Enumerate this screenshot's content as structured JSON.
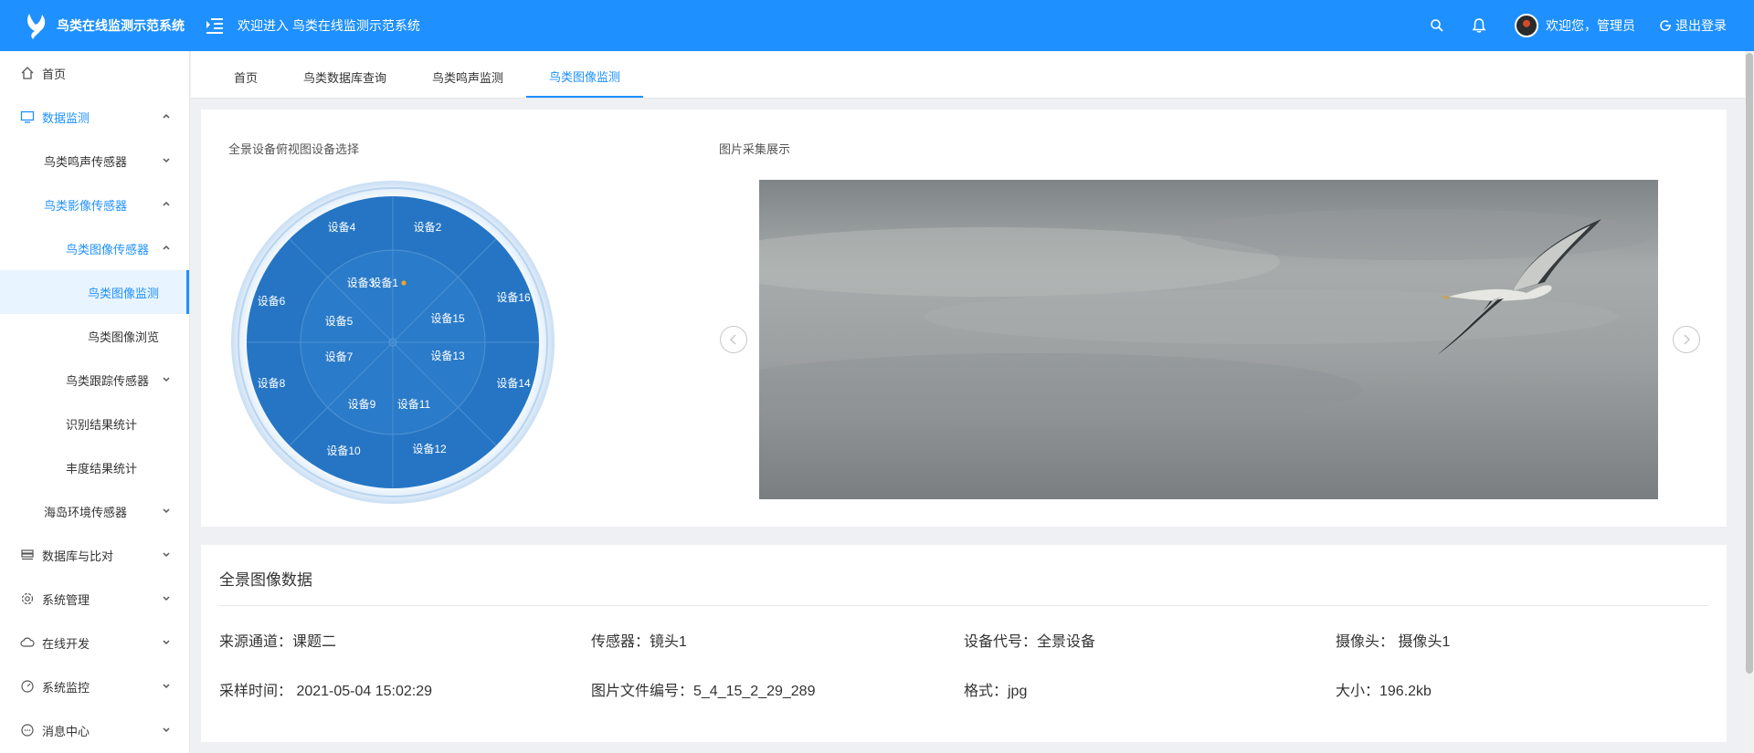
{
  "header": {
    "app_title": "鸟类在线监测示范系统",
    "welcome": "欢迎进入 鸟类在线监测示范系统",
    "user_greeting": "欢迎您，管理员",
    "logout": "退出登录"
  },
  "sidebar": {
    "items": [
      {
        "label": "首页",
        "icon": "home-icon"
      },
      {
        "label": "数据监测",
        "icon": "monitor-icon"
      },
      {
        "label": "鸟类鸣声传感器"
      },
      {
        "label": "鸟类影像传感器"
      },
      {
        "label": "鸟类图像传感器"
      },
      {
        "label": "鸟类图像监测"
      },
      {
        "label": "鸟类图像浏览"
      },
      {
        "label": "鸟类跟踪传感器"
      },
      {
        "label": "识别结果统计"
      },
      {
        "label": "丰度结果统计"
      },
      {
        "label": "海岛环境传感器"
      },
      {
        "label": "数据库与比对",
        "icon": "database-icon"
      },
      {
        "label": "系统管理",
        "icon": "gear-icon"
      },
      {
        "label": "在线开发",
        "icon": "cloud-icon"
      },
      {
        "label": "系统监控",
        "icon": "dashboard-icon"
      },
      {
        "label": "消息中心",
        "icon": "message-icon"
      }
    ]
  },
  "tabs": [
    "首页",
    "鸟类数据库查询",
    "鸟类鸣声监测",
    "鸟类图像监测"
  ],
  "selector": {
    "title": "全景设备俯视图设备选择",
    "devices": [
      "设备1",
      "设备2",
      "设备3",
      "设备4",
      "设备5",
      "设备6",
      "设备7",
      "设备8",
      "设备9",
      "设备10",
      "设备11",
      "设备12",
      "设备13",
      "设备14",
      "设备15",
      "设备16"
    ],
    "selected": "设备1",
    "accent": "#f5a623"
  },
  "gallery": {
    "title": "图片采集展示"
  },
  "panorama": {
    "title": "全景图像数据",
    "source_channel": "来源通道：课题二",
    "sensor": "传感器：镜头1",
    "device_code": "设备代号：全景设备",
    "camera": "摄像头： 摄像头1",
    "sample_time": "采样时间： 2021-05-04 15:02:29",
    "file_number": "图片文件编号：5_4_15_2_29_289",
    "format": "格式：jpg",
    "size": "大小：196.2kb"
  },
  "colors": {
    "primary": "#1e90ff",
    "radar_fill": "#2575c4"
  }
}
